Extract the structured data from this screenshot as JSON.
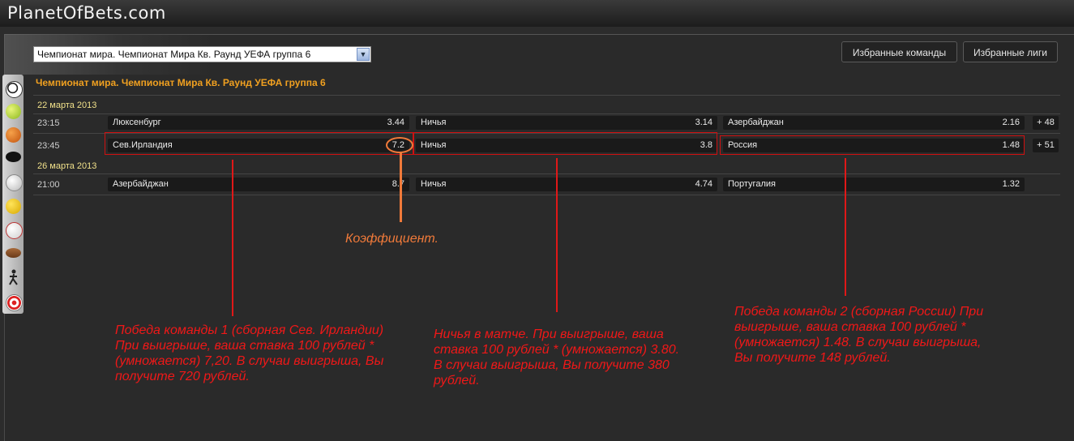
{
  "header": {
    "logo": "PlanetOfBets.com"
  },
  "league_select": {
    "value": "Чемпионат мира. Чемпионат Мира Кв. Раунд УЕФА группа 6"
  },
  "buttons": {
    "fav_teams": "Избранные команды",
    "fav_leagues": "Избранные лиги"
  },
  "league_title": "Чемпионат мира. Чемпионат Мира Кв. Раунд УЕФА группа 6",
  "sports_icons": [
    "soccer-ball-icon",
    "tennis-ball-icon",
    "basketball-icon",
    "hockey-puck-icon",
    "volleyball-icon",
    "handball-icon",
    "baseball-icon",
    "american-football-icon",
    "athletics-icon",
    "darts-target-icon"
  ],
  "groups": [
    {
      "date": "22 марта 2013",
      "matches": [
        {
          "time": "23:15",
          "team1": "Люксенбург",
          "odd1": "3.44",
          "draw": "Ничья",
          "oddx": "3.14",
          "team2": "Азербайджан",
          "odd2": "2.16",
          "more": "+ 48"
        },
        {
          "time": "23:45",
          "team1": "Сев.Ирландия",
          "odd1": "7.2",
          "draw": "Ничья",
          "oddx": "3.8",
          "team2": "Россия",
          "odd2": "1.48",
          "more": "+ 51"
        }
      ]
    },
    {
      "date": "26 марта 2013",
      "matches": [
        {
          "time": "21:00",
          "team1": "Азербайджан",
          "odd1": "8.7",
          "draw": "Ничья",
          "oddx": "4.74",
          "team2": "Португалия",
          "odd2": "1.32",
          "more": ""
        }
      ]
    }
  ],
  "annotations": {
    "coef": "Коэффициент.",
    "win1": "Победа команды 1 (сборная Сев. Ирландии)\nПри выигрыше, ваша ставка 100 рублей *\n(умножается) 7,20. В случаи выигрыша, Вы\nполучите 720 рублей.",
    "draw": "Ничья в матче. При выигрыше, ваша\nставка 100 рублей * (умножается) 3.80.\nВ случаи выигрыша, Вы получите 380\nрублей.",
    "win2": "Победа команды 2 (сборная России) При\nвыигрыше, ваша ставка 100 рублей *\n(умножается) 1.48. В случаи выигрыша,\nВы получите 148 рублей."
  },
  "colors": {
    "accent_orange": "#f0a020",
    "annotation_red": "#f01818",
    "coef_orange": "#f07a3a"
  }
}
